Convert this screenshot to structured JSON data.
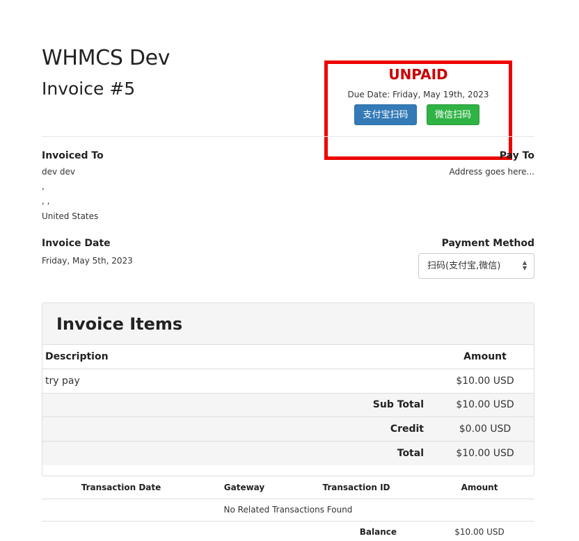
{
  "header": {
    "company": "WHMCS Dev",
    "invoice_number": "Invoice #5"
  },
  "status": {
    "label": "UNPAID",
    "due_date": "Due Date: Friday, May 19th, 2023",
    "alipay_button": "支付宝扫码",
    "wechat_button": "微信扫码",
    "highlight_color": "#ee0000"
  },
  "invoiced_to": {
    "label": "Invoiced To",
    "lines": [
      "dev dev",
      ",",
      ", ,",
      "United States"
    ]
  },
  "pay_to": {
    "label": "Pay To",
    "address": "Address goes here..."
  },
  "invoice_date": {
    "label": "Invoice Date",
    "value": "Friday, May 5th, 2023"
  },
  "payment_method": {
    "label": "Payment Method",
    "selected": "扫码(支付宝,微信)"
  },
  "items": {
    "title": "Invoice Items",
    "headers": {
      "description": "Description",
      "amount": "Amount"
    },
    "rows": [
      {
        "description": "try pay",
        "amount": "$10.00 USD"
      }
    ],
    "summary": [
      {
        "label": "Sub Total",
        "amount": "$10.00 USD"
      },
      {
        "label": "Credit",
        "amount": "$0.00 USD"
      },
      {
        "label": "Total",
        "amount": "$10.00 USD"
      }
    ]
  },
  "transactions": {
    "headers": [
      "Transaction Date",
      "Gateway",
      "Transaction ID",
      "Amount"
    ],
    "empty_message": "No Related Transactions Found",
    "balance_label": "Balance",
    "balance_amount": "$10.00 USD"
  }
}
